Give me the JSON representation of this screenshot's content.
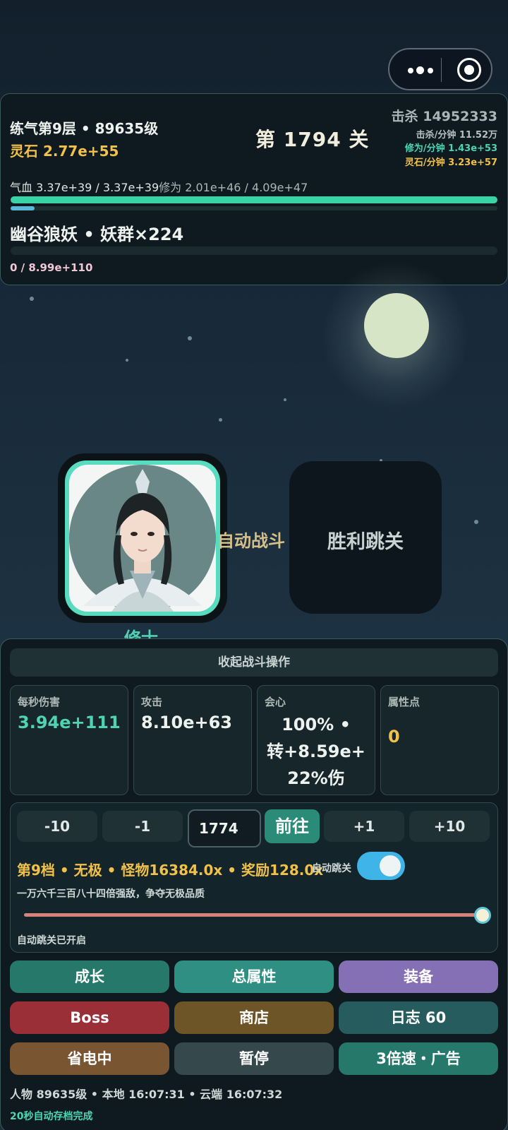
{
  "player": {
    "realm": "练气第9层 • 89635级",
    "spirit_stone": "灵石 2.77e+55",
    "hp": "气血 3.37e+39 / 3.37e+39",
    "cultivation": "修为 2.01e+46 / 4.09e+47",
    "hp_fraction": 1.0,
    "cultivation_fraction": 0.049
  },
  "stage": {
    "title": "第 1794 关"
  },
  "stats_top": {
    "kills": "击杀 14952333",
    "kills_per_min": "击杀/分钟 11.52万",
    "cultivation_per_min": "修为/分钟 1.43e+53",
    "stone_per_min": "灵石/分钟 3.23e+57"
  },
  "enemy": {
    "name": "幽谷狼妖 • 妖群×224",
    "hp": "0 / 8.99e+110",
    "hp_fraction": 0
  },
  "scene": {
    "hero_name": "修士",
    "auto_battle": "自动战斗",
    "skip_label": "胜利跳关"
  },
  "battle_panel": {
    "collapse_label": "收起战斗操作",
    "stats": [
      {
        "label": "每秒伤害",
        "value": "3.94e+111",
        "color": "#4fd3b5"
      },
      {
        "label": "攻击",
        "value": "8.10e+63",
        "color": "#eef2ee"
      },
      {
        "label": "会心",
        "lines": [
          "100% •",
          "转+8.59e+",
          "22%伤"
        ],
        "color": "#eef2ee"
      },
      {
        "label": "属性点",
        "value": "0",
        "color": "#f2c14a"
      }
    ]
  },
  "level_control": {
    "minus10": "-10",
    "minus1": "-1",
    "input_value": "1774",
    "go_label": "前往",
    "plus1": "+1",
    "plus10": "+10",
    "tier_text": "第9档 • 无极 • 怪物16384.0x • 奖励128.0x",
    "autoskip_label": "自动跳关",
    "autoskip_on": true,
    "tier_desc": "一万六千三百八十四倍强敌，争夺无极品质",
    "slider_fraction": 1.0,
    "autoskip_status": "自动跳关已开启"
  },
  "menu": [
    {
      "label": "成长",
      "color": "#25786a"
    },
    {
      "label": "总属性",
      "color": "#2f8f82"
    },
    {
      "label": "装备",
      "color": "#8670b5"
    },
    {
      "label": "Boss",
      "color": "#9a2f38"
    },
    {
      "label": "商店",
      "color": "#6e5527"
    },
    {
      "label": "日志 60",
      "color": "#275c5e"
    },
    {
      "label": "省电中",
      "color": "#7a5532"
    },
    {
      "label": "暂停",
      "color": "#35484c"
    },
    {
      "label": "3倍速・广告",
      "color": "#25786a"
    }
  ],
  "footer": {
    "status": "人物 89635级 • 本地 16:07:31 • 云端 16:07:32",
    "save_notice": "20秒自动存档完成"
  }
}
